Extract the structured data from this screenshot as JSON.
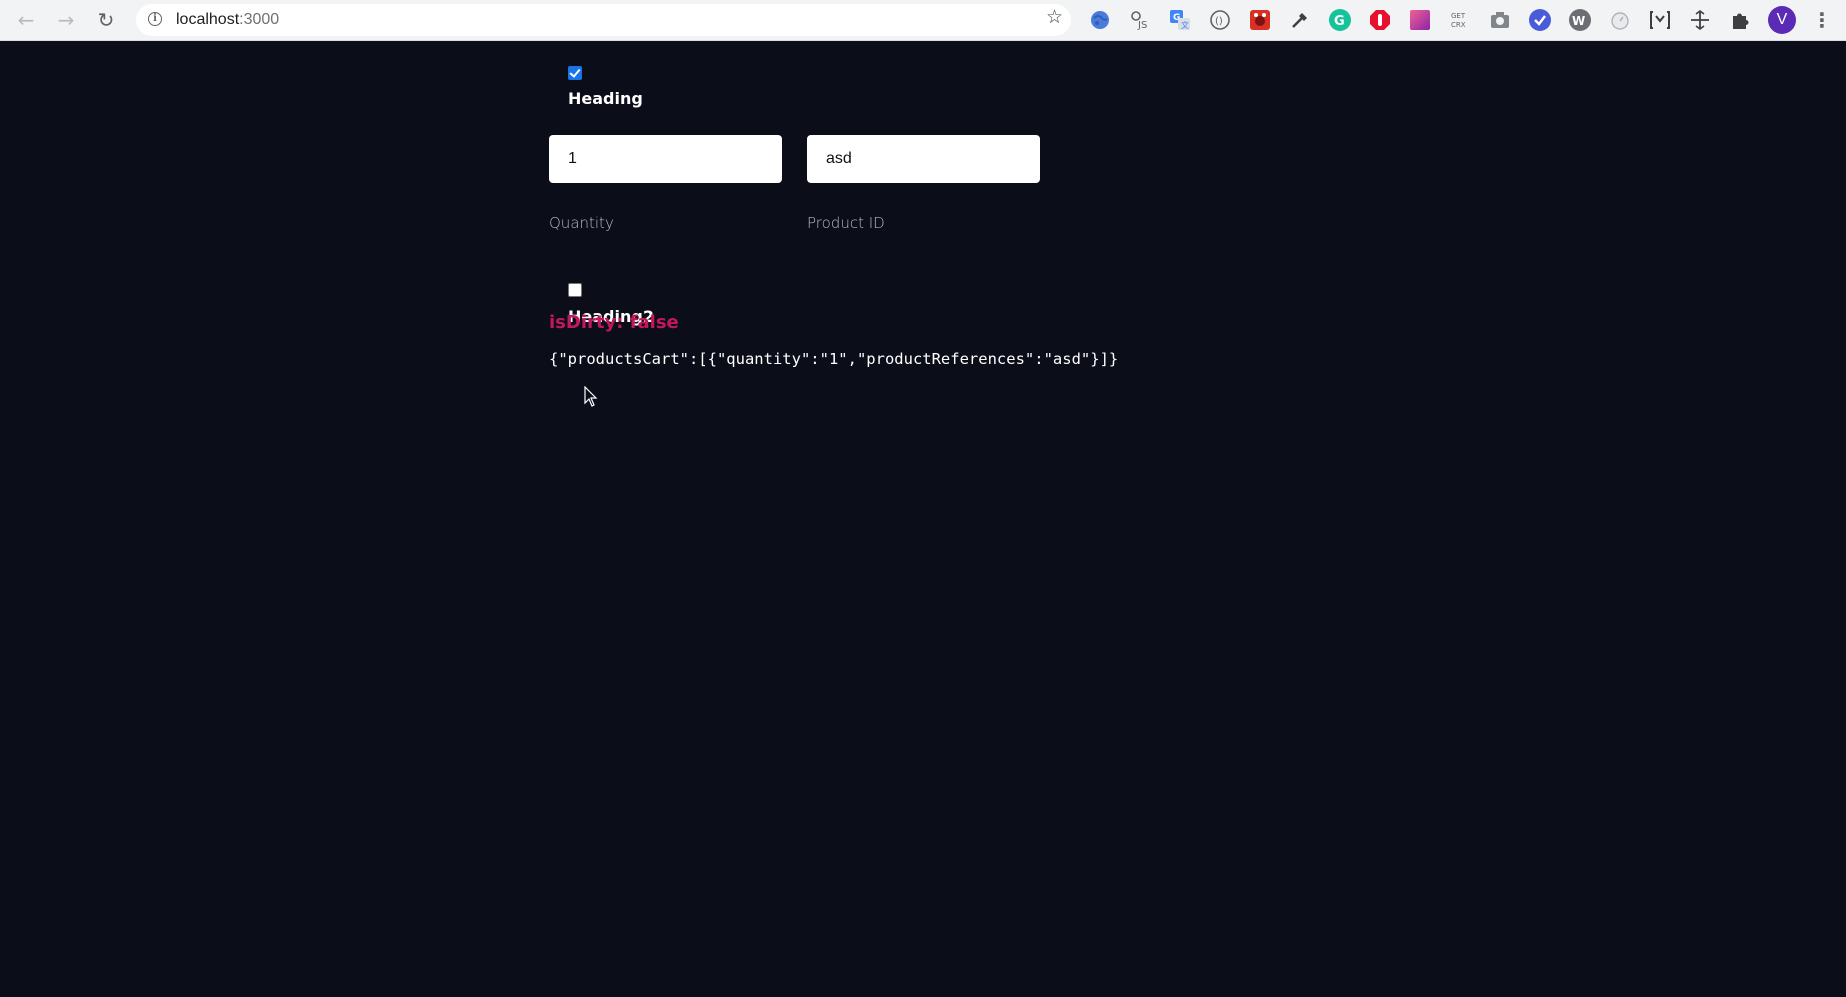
{
  "browser": {
    "url_host": "localhost",
    "url_port": ":3000",
    "profile_initial": "V",
    "extensions": [
      {
        "name": "web-globe-icon",
        "color": "#4a7bd8"
      },
      {
        "name": "js-icon",
        "glyph": "JS",
        "color": "#5f6368"
      },
      {
        "name": "google-translate-icon",
        "glyph": "G",
        "color": "#4285f4"
      },
      {
        "name": "circle-bracket-icon",
        "color": "#5f6368"
      },
      {
        "name": "red-bug-icon",
        "color": "#d93025"
      },
      {
        "name": "eyedropper-icon",
        "color": "#3c4043"
      },
      {
        "name": "grammarly-icon",
        "glyph": "G",
        "color": "#15c39a"
      },
      {
        "name": "stop-icon",
        "color": "#e8112d"
      },
      {
        "name": "gradient-icon",
        "color": "#c9429b"
      },
      {
        "name": "get-crx-icon",
        "glyph": "GET CRX",
        "color": "#5f6368"
      },
      {
        "name": "camera-icon",
        "color": "#80868b"
      },
      {
        "name": "check-badge-icon",
        "color": "#4a5bd8"
      },
      {
        "name": "wordpress-icon",
        "glyph": "W",
        "color": "#6b6f73"
      },
      {
        "name": "timer-icon",
        "color": "#b0b4b8"
      },
      {
        "name": "bracket-cursor-icon",
        "color": "#3c4043"
      },
      {
        "name": "move-cross-icon",
        "color": "#3c4043"
      },
      {
        "name": "puzzle-icon",
        "color": "#3c4043"
      }
    ]
  },
  "form": {
    "heading1": {
      "label": "Heading",
      "checked": true
    },
    "quantity": {
      "value": "1",
      "label": "Quantity"
    },
    "product_id": {
      "value": "asd",
      "label": "Product ID"
    },
    "heading2": {
      "label": "Heading2",
      "checked": false
    },
    "dirty_text": "isDirty: false",
    "json_output": "{\"productsCart\":[{\"quantity\":\"1\",\"productReferences\":\"asd\"}]}"
  },
  "colors": {
    "page_bg": "#0b0e18",
    "dirty_accent": "#c2185b",
    "checkbox_accent": "#1a73e8"
  }
}
